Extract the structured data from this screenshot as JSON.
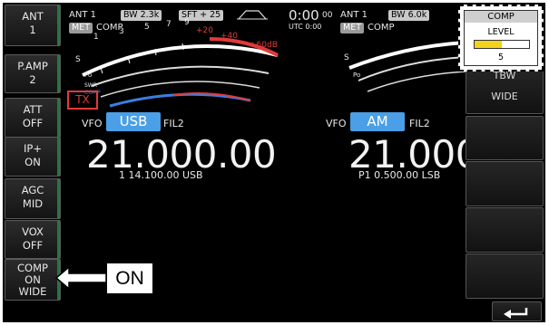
{
  "left_menu": [
    {
      "line1": "ANT",
      "line2": "1"
    },
    {
      "line1": "P.AMP",
      "line2": "2"
    },
    {
      "line1": "ATT",
      "line2": "OFF"
    },
    {
      "line1": "IP+",
      "line2": "ON"
    },
    {
      "line1": "AGC",
      "line2": "MID"
    },
    {
      "line1": "VOX",
      "line2": "OFF"
    },
    {
      "line1": "COMP",
      "line2": "ON",
      "line3": "WIDE"
    }
  ],
  "main_vfo": {
    "ant": "ANT 1",
    "bw": "BW 2.3k",
    "sft": "SFT + 25",
    "met": "MET",
    "comp_tag": "COMP",
    "tx": "TX",
    "vfo_label": "VFO",
    "mode": "USB",
    "filter": "FIL2",
    "frequency": "21.000.00",
    "sub_line": "1  14.100.00  USB",
    "scale_top": [
      "1",
      "3",
      "5",
      "7",
      "9",
      "+20",
      "+40",
      "+60dB"
    ],
    "scale_labels": [
      "S",
      "Po",
      "SWR",
      "COMP"
    ]
  },
  "sub_vfo": {
    "clock": "0:00",
    "clock_sec": "00",
    "utc": "UTC  0:00",
    "ant": "ANT 1",
    "bw": "BW 6.0k",
    "met": "MET",
    "comp_tag": "COMP",
    "vfo_label": "VFO",
    "mode": "AM",
    "filter": "FIL2",
    "frequency": "21.000.",
    "sub_line": "P1   0.500.00  LSB"
  },
  "right_menu": {
    "item1_line1": "TBW",
    "item1_line2": "WIDE"
  },
  "comp_popup": {
    "title": "COMP",
    "label": "LEVEL",
    "value": "5",
    "level_fraction": 0.5
  },
  "annotation": {
    "label": "ON"
  },
  "colors": {
    "screen_bg": "#000000",
    "mode_badge": "#4a9fe6",
    "tx_badge": "#e23a3a",
    "meter_red": "#e23a3a",
    "meter_blue": "#3a7fe0",
    "level_bar": "#f2d21b"
  },
  "icons": {
    "filter_shape": "filter-passband-icon",
    "return": "return-arrow-icon",
    "pointer": "hollow-left-arrow-icon"
  }
}
